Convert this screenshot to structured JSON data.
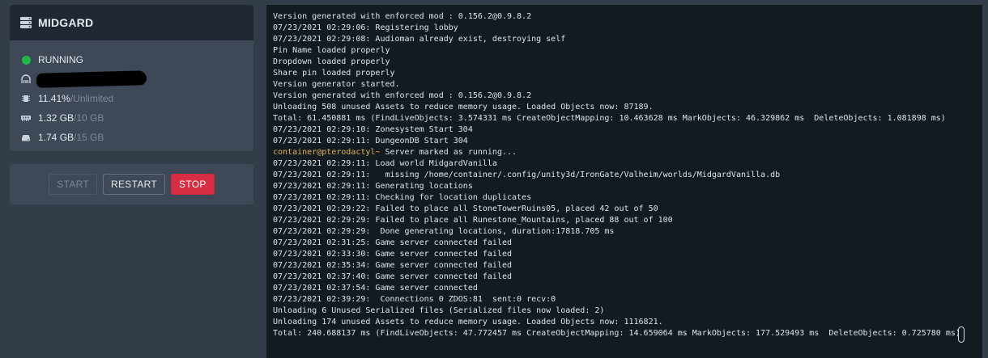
{
  "server": {
    "name": "MIDGARD",
    "status": "RUNNING",
    "status_color": "#21b84a",
    "address_redacted": true,
    "cpu": {
      "value": "11.41%",
      "separator": " / ",
      "limit": "Unlimited"
    },
    "memory": {
      "value": "1.32 GB",
      "separator": " / ",
      "limit": "10 GB"
    },
    "disk": {
      "value": "1.74 GB",
      "separator": " / ",
      "limit": "15 GB"
    }
  },
  "power": {
    "start_label": "START",
    "restart_label": "RESTART",
    "stop_label": "STOP",
    "stop_color": "#d72e44"
  },
  "console": {
    "lines": [
      {
        "text": "Version generated with enforced mod : 0.156.2@0.9.8.2"
      },
      {
        "text": "07/23/2021 02:29:06: Registering lobby"
      },
      {
        "text": "07/23/2021 02:29:08: Audioman already exist, destroying self"
      },
      {
        "text": "Pin Name loaded properly"
      },
      {
        "text": "Dropdown loaded properly"
      },
      {
        "text": "Share pin loaded properly"
      },
      {
        "text": "Version generator started."
      },
      {
        "text": "Version generated with enforced mod : 0.156.2@0.9.8.2"
      },
      {
        "text": "Unloading 508 unused Assets to reduce memory usage. Loaded Objects now: 87189."
      },
      {
        "text": "Total: 61.450881 ms (FindLiveObjects: 3.574331 ms CreateObjectMapping: 10.463628 ms MarkObjects: 46.329862 ms  DeleteObjects: 1.081898 ms)"
      },
      {
        "text": "07/23/2021 02:29:10: Zonesystem Start 304"
      },
      {
        "text": "07/23/2021 02:29:11: DungeonDB Start 304"
      },
      {
        "prompt": "container@pterodactyl~",
        "text": " Server marked as running..."
      },
      {
        "text": "07/23/2021 02:29:11: Load world MidgardVanilla"
      },
      {
        "text": "07/23/2021 02:29:11:   missing /home/container/.config/unity3d/IronGate/Valheim/worlds/MidgardVanilla.db"
      },
      {
        "text": "07/23/2021 02:29:11: Generating locations"
      },
      {
        "text": "07/23/2021 02:29:11: Checking for location duplicates"
      },
      {
        "text": "07/23/2021 02:29:22: Failed to place all StoneTowerRuins05, placed 42 out of 50"
      },
      {
        "text": "07/23/2021 02:29:29: Failed to place all Runestone_Mountains, placed 88 out of 100"
      },
      {
        "text": "07/23/2021 02:29:29:  Done generating locations, duration:17818.705 ms"
      },
      {
        "text": "07/23/2021 02:31:25: Game server connected failed"
      },
      {
        "text": "07/23/2021 02:33:30: Game server connected failed"
      },
      {
        "text": "07/23/2021 02:35:34: Game server connected failed"
      },
      {
        "text": "07/23/2021 02:37:40: Game server connected failed"
      },
      {
        "text": "07/23/2021 02:37:54: Game server connected"
      },
      {
        "text": "07/23/2021 02:39:29:  Connections 0 ZDOS:81  sent:0 recv:0"
      },
      {
        "text": "Unloading 6 Unused Serialized files (Serialized files now loaded: 2)"
      },
      {
        "text": "Unloading 174 unused Assets to reduce memory usage. Loaded Objects now: 1116821."
      },
      {
        "text": "Total: 240.688137 ms (FindLiveObjects: 47.772457 ms CreateObjectMapping: 14.659064 ms MarkObjects: 177.529493 ms  DeleteObjects: 0.725780 ms)"
      }
    ]
  }
}
